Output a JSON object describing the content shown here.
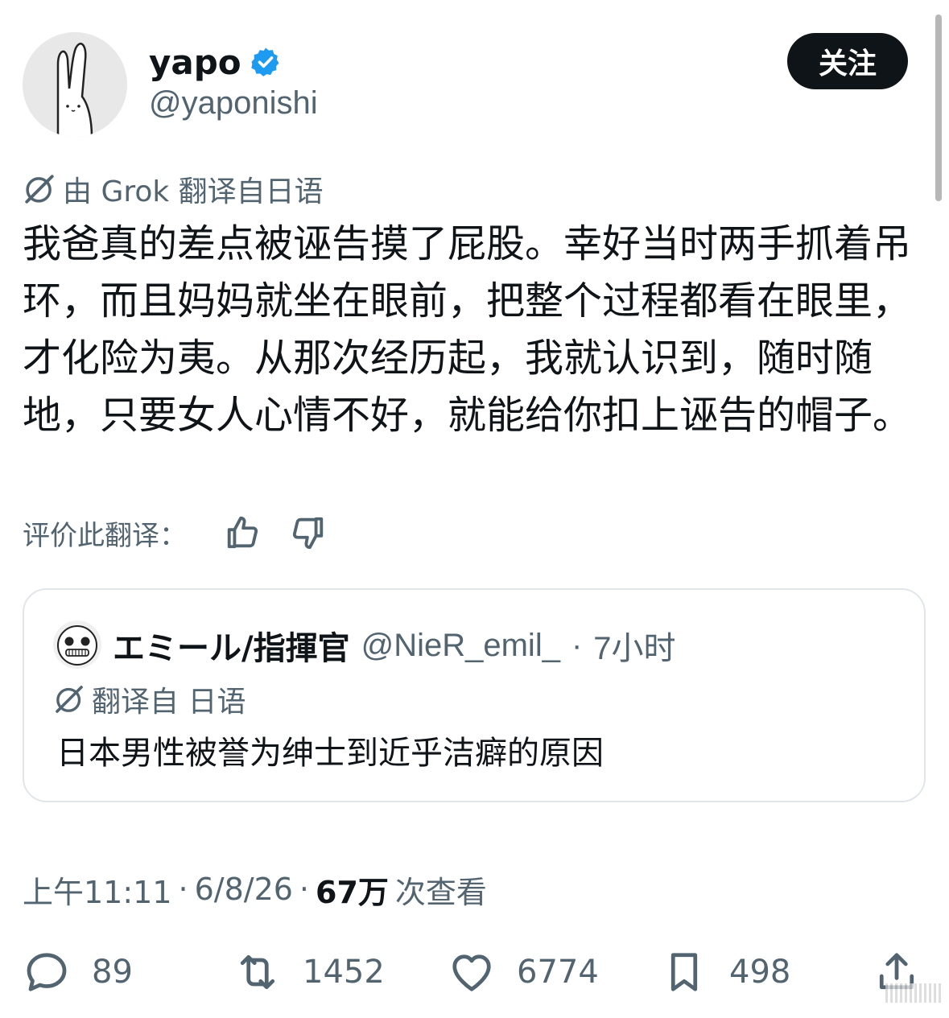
{
  "header": {
    "display_name": "yapo",
    "verified": true,
    "handle": "@yaponishi",
    "follow_label": "关注"
  },
  "translation": {
    "label": "由 Grok 翻译自日语"
  },
  "tweet": {
    "text": "我爸真的差点被诬告摸了屁股。幸好当时两手抓着吊环，而且妈妈就坐在眼前，把整个过程都看在眼里，才化险为夷。从那次经历起，我就认识到，随时随地，只要女人心情不好，就能给你扣上诬告的帽子。"
  },
  "rate": {
    "label": "评价此翻译："
  },
  "quote": {
    "name": "エミール/指揮官",
    "handle": "@NieR_emil_",
    "separator": "·",
    "time": "7小时",
    "translated_label": "翻译自 日语",
    "text": "日本男性被誉为绅士到近乎洁癖的原因"
  },
  "meta": {
    "time": "上午11:11",
    "sep1": "·",
    "date": "6/8/26",
    "sep2": "·",
    "views_count": "67万",
    "views_label": "次查看"
  },
  "actions": {
    "replies": "89",
    "retweets": "1452",
    "likes": "6774",
    "bookmarks": "498"
  },
  "colors": {
    "text_primary": "#0f1419",
    "text_secondary": "#536471",
    "verified_blue": "#1d9bf0",
    "follow_bg": "#0f1419",
    "card_border": "#e2e6ea"
  }
}
